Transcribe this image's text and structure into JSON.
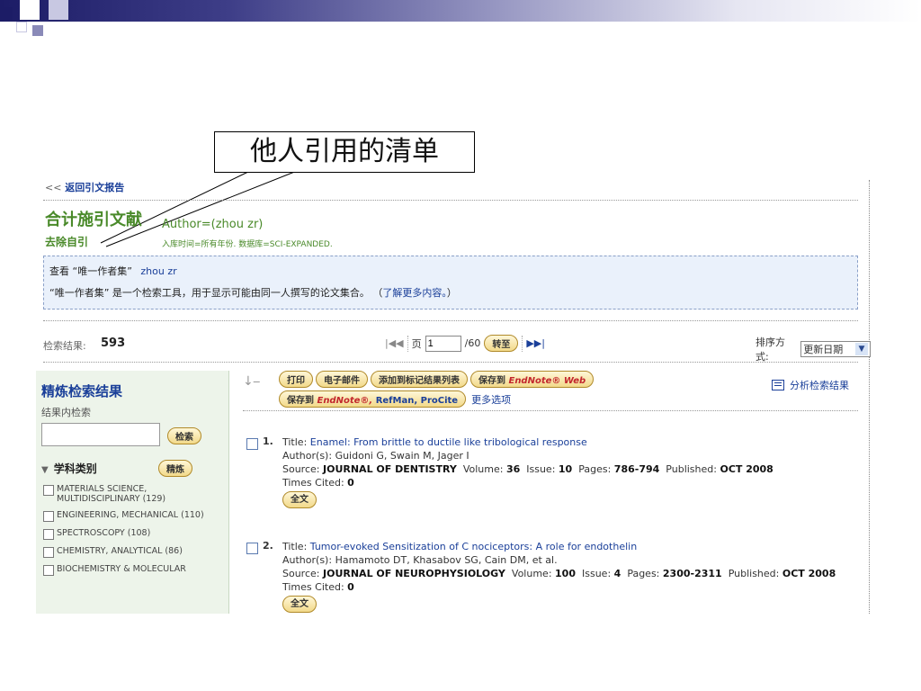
{
  "callout": {
    "text": "他人引用的清单"
  },
  "back_link": {
    "arrow": "<<",
    "label": "返回引文报告"
  },
  "header": {
    "title": "合计施引文献",
    "author_query": "Author=(zhou zr)",
    "remove_self": "去除自引",
    "meta": "入库时间=所有年份. 数据库=SCI-EXPANDED."
  },
  "notice": {
    "line1_prefix": "查看 “唯一作者集”",
    "line1_name": "zhou zr",
    "line2_text": "“唯一作者集” 是一个检索工具，用于显示可能由同一人撰写的论文集合。",
    "line2_link_open": "（",
    "line2_link": "了解更多内容。",
    "line2_link_close": "）"
  },
  "results_bar": {
    "label": "检索结果:",
    "count": "593",
    "page_label": "页",
    "page_value": "1",
    "page_total": "/60",
    "go_label": "转至",
    "sort_label": "排序方式:",
    "sort_value": "更新日期"
  },
  "sidebar": {
    "title": "精炼检索结果",
    "within_label": "结果内检索",
    "search_button": "检索",
    "category_label": "学科类别",
    "refine_button": "精炼",
    "categories": [
      "MATERIALS SCIENCE, MULTIDISCIPLINARY (129)",
      "ENGINEERING, MECHANICAL (110)",
      "SPECTROSCOPY (108)",
      "CHEMISTRY, ANALYTICAL (86)",
      "BIOCHEMISTRY & MOLECULAR"
    ]
  },
  "actions": {
    "print": "打印",
    "email": "电子邮件",
    "add_marked": "添加到标记结果列表",
    "save_to": "保存到",
    "endnote_web": "EndNote® Web",
    "save_to2": "保存到",
    "endnote": "EndNote®,",
    "refman": "RefMan, ProCite",
    "more_options": "更多选项",
    "analyze": "分析检索结果"
  },
  "records": [
    {
      "num": "1.",
      "title_label": "Title:",
      "title": "Enamel: From brittle to ductile like tribological response",
      "authors_label": "Author(s):",
      "authors": "Guidoni G, Swain M, Jager I",
      "source_label": "Source:",
      "journal": "JOURNAL OF DENTISTRY",
      "volume_label": "Volume:",
      "volume": "36",
      "issue_label": "Issue:",
      "issue": "10",
      "pages_label": "Pages:",
      "pages": "786-794",
      "published_label": "Published:",
      "published": "OCT 2008",
      "cited_label": "Times Cited:",
      "cited": "0",
      "fulltext": "全文"
    },
    {
      "num": "2.",
      "title_label": "Title:",
      "title": "Tumor-evoked Sensitization of C nociceptors: A role for endothelin",
      "authors_label": "Author(s):",
      "authors": "Hamamoto DT, Khasabov SG, Cain DM, et al.",
      "source_label": "Source:",
      "journal": "JOURNAL OF NEUROPHYSIOLOGY",
      "volume_label": "Volume:",
      "volume": "100",
      "issue_label": "Issue:",
      "issue": "4",
      "pages_label": "Pages:",
      "pages": "2300-2311",
      "published_label": "Published:",
      "published": "OCT 2008",
      "cited_label": "Times Cited:",
      "cited": "0",
      "fulltext": "全文"
    }
  ]
}
